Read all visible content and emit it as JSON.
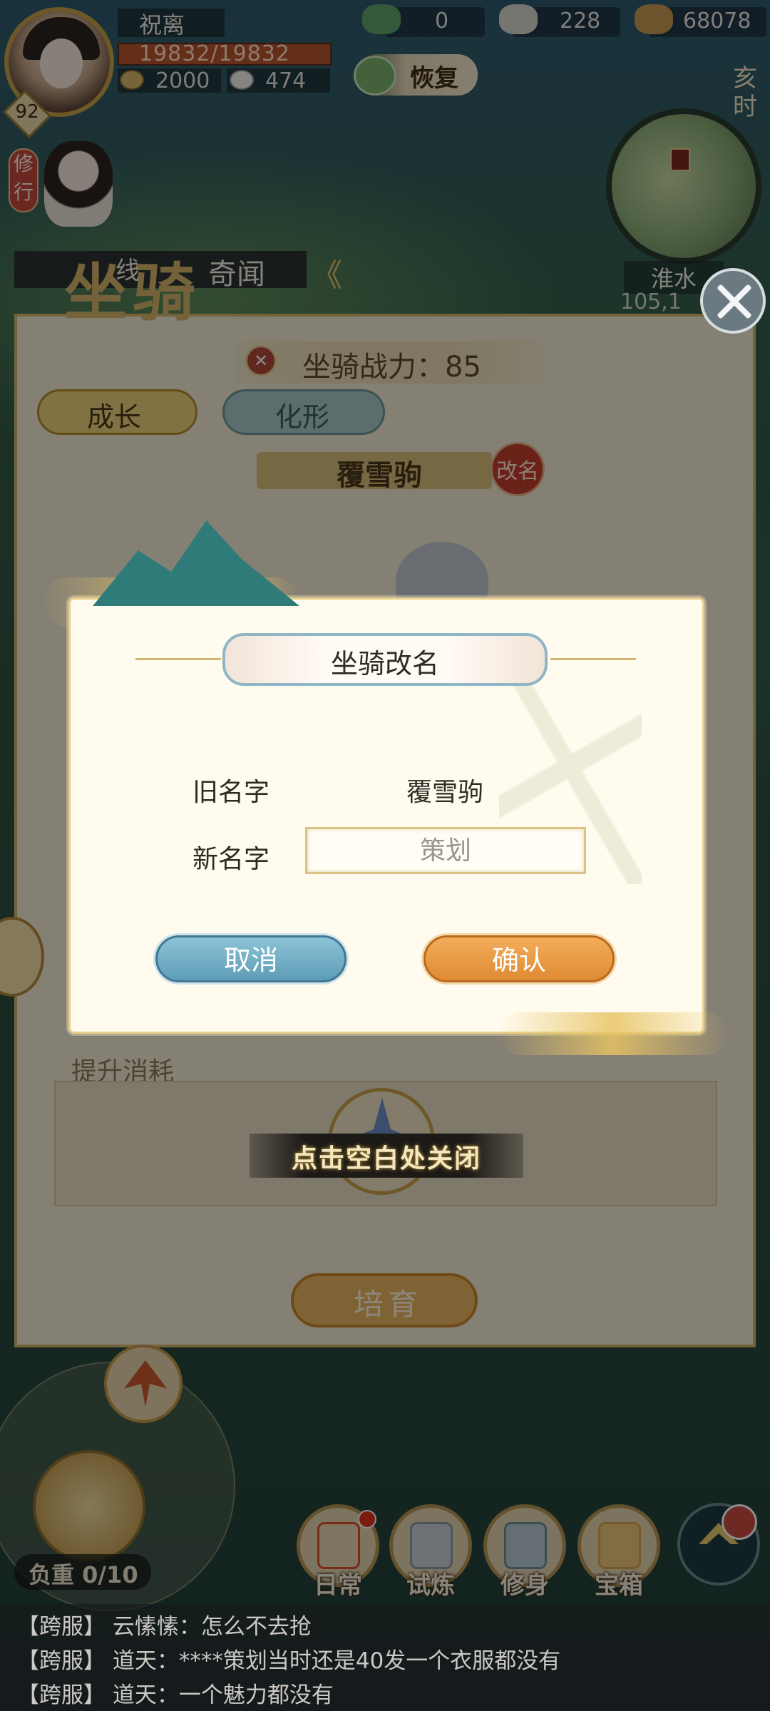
{
  "player": {
    "name": "祝离",
    "hp": "19832/19832",
    "stat1": "2000",
    "stat2": "474",
    "level": "92"
  },
  "resources": [
    {
      "icon": "jade-dragon-icon",
      "value": "0"
    },
    {
      "icon": "silver-ingot-icon",
      "value": "228"
    },
    {
      "icon": "copper-coins-icon",
      "value": "68078"
    }
  ],
  "hud": {
    "recover_label": "恢复",
    "time_label": "亥时",
    "train_label": "修行",
    "location": "淮水",
    "coords": "105,1",
    "weight_label": "负重 0/10"
  },
  "mount_panel": {
    "title": "坐骑",
    "tab_line": "线",
    "tab_qiwen": "奇闻",
    "tab_arrows": "《",
    "power": "坐骑战力：85",
    "tabs": [
      "成长",
      "化形"
    ],
    "mount_name": "覆雪驹",
    "rename_badge": "改名",
    "cost_label": "提升消耗",
    "cultivate_label": "培育"
  },
  "dialog": {
    "title": "坐骑改名",
    "old_name_label": "旧名字",
    "old_name_value": "覆雪驹",
    "new_name_label": "新名字",
    "new_name_placeholder": "策划",
    "cancel_label": "取消",
    "confirm_label": "确认",
    "dismiss_hint": "点击空白处关闭"
  },
  "bottom_menu": [
    {
      "label": "日常",
      "icon": "daily-scroll-icon",
      "color": "#d94f2f"
    },
    {
      "label": "试炼",
      "icon": "trial-hat-icon",
      "color": "#8a9aa6"
    },
    {
      "label": "修身",
      "icon": "cultivate-book-icon",
      "color": "#6a8e9e"
    },
    {
      "label": "宝箱",
      "icon": "treasure-chest-icon",
      "color": "#d8a24a"
    }
  ],
  "chat": [
    {
      "tag": "【跨服】",
      "speaker": "云愫愫",
      "text": "怎么不去抢"
    },
    {
      "tag": "【跨服】",
      "speaker": "道天",
      "text": "****策划当时还是40发一个衣服都没有"
    },
    {
      "tag": "【跨服】",
      "speaker": "道天",
      "text": "一个魅力都没有"
    }
  ],
  "chat_text": [
    "【跨服】  云愫愫：怎么不去抢",
    "【跨服】  道天：****策划当时还是40发一个衣服都没有",
    "【跨服】  道天：一个魅力都没有"
  ]
}
